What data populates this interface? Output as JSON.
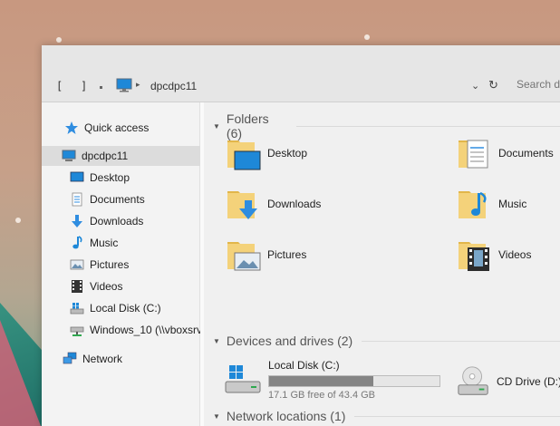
{
  "address": {
    "location": "dpcdpc11",
    "search_placeholder": "Search dp"
  },
  "sidebar": {
    "quick_access": "Quick access",
    "pc": "dpcdpc11",
    "items": [
      {
        "label": "Desktop",
        "icon": "desktop-icon"
      },
      {
        "label": "Documents",
        "icon": "documents-icon"
      },
      {
        "label": "Downloads",
        "icon": "downloads-icon"
      },
      {
        "label": "Music",
        "icon": "music-icon"
      },
      {
        "label": "Pictures",
        "icon": "pictures-icon"
      },
      {
        "label": "Videos",
        "icon": "videos-icon"
      },
      {
        "label": "Local Disk (C:)",
        "icon": "local-disk-icon"
      },
      {
        "label": "Windows_10 (\\\\vboxsrv",
        "icon": "network-drive-icon"
      }
    ],
    "network": "Network"
  },
  "content": {
    "folders_header": "Folders (6)",
    "folders": [
      {
        "label": "Desktop",
        "icon": "desktop-folder-icon"
      },
      {
        "label": "Documents",
        "icon": "documents-folder-icon"
      },
      {
        "label": "Downloads",
        "icon": "downloads-folder-icon"
      },
      {
        "label": "Music",
        "icon": "music-folder-icon"
      },
      {
        "label": "Pictures",
        "icon": "pictures-folder-icon"
      },
      {
        "label": "Videos",
        "icon": "videos-folder-icon"
      }
    ],
    "devices_header": "Devices and drives (2)",
    "drives": [
      {
        "label": "Local Disk (C:)",
        "free_text": "17.1 GB free of 43.4 GB",
        "used_fraction": 0.61
      },
      {
        "label": "CD Drive (D:)"
      }
    ],
    "network_header": "Network locations (1)"
  },
  "colors": {
    "accent_blue": "#1e88d8",
    "folder_yellow": "#f4d27a",
    "selected_bg": "#dcdcdc"
  }
}
